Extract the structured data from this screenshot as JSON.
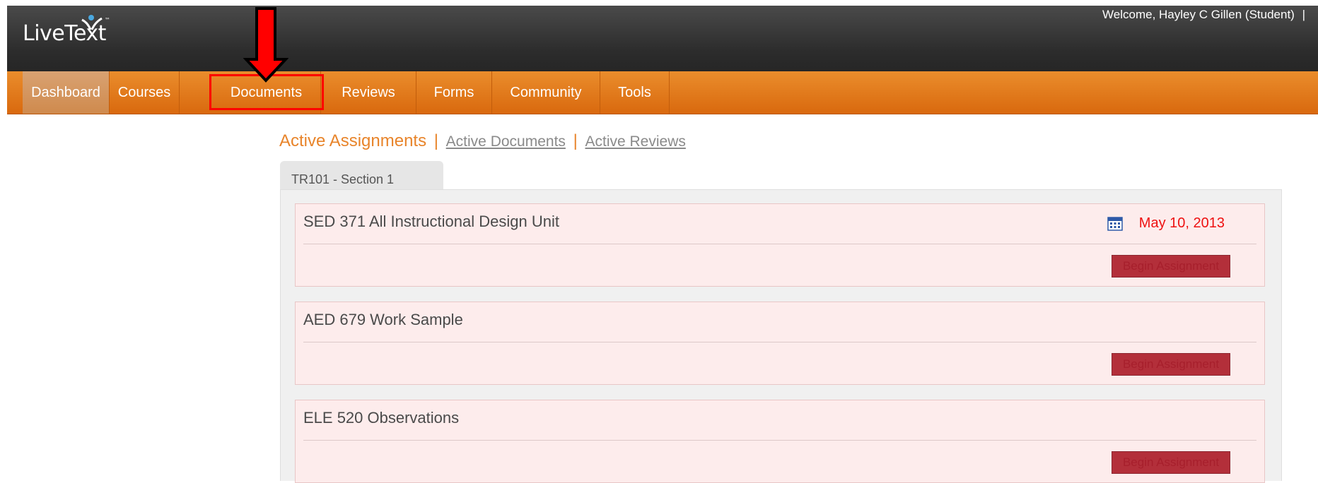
{
  "header": {
    "logo_text": "LiveText",
    "welcome": "Welcome, Hayley C Gillen (Student)"
  },
  "nav": {
    "items": [
      "Dashboard",
      "Courses",
      "Documents",
      "Reviews",
      "Forms",
      "Community",
      "Tools"
    ],
    "active": "Dashboard",
    "highlighted": "Documents"
  },
  "subnav": {
    "current": "Active Assignments",
    "link1": "Active Documents",
    "link2": "Active Reviews",
    "separator": "|"
  },
  "tab": {
    "label": "TR101 - Section 1"
  },
  "assignments": [
    {
      "title": "SED 371 All Instructional Design Unit",
      "due": "May 10, 2013",
      "button": "Begin Assignment"
    },
    {
      "title": "AED 679 Work Sample",
      "due": "",
      "button": "Begin Assignment"
    },
    {
      "title": "ELE 520 Observations",
      "due": "",
      "button": "Begin Assignment"
    }
  ],
  "colors": {
    "accent": "#e8842a",
    "nav_bg": "#d9690e",
    "header_bg": "#2c2c2c",
    "annotation_red": "#ff0000",
    "due_red": "#ee1111",
    "button_bg": "#b32f3a"
  },
  "icons": {
    "calendar": "calendar-icon",
    "annotation": "down-arrow-icon"
  }
}
